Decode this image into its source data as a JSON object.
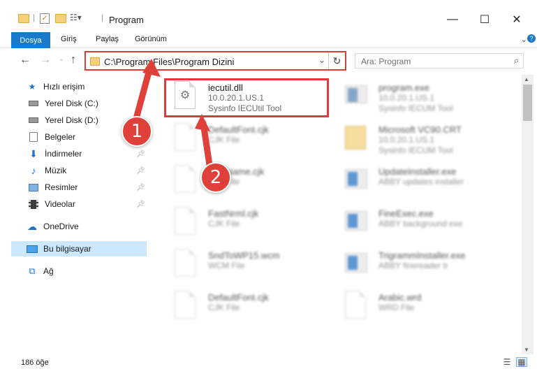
{
  "window": {
    "title": "Program",
    "minimize_glyph": "—",
    "maximize_glyph": "☐",
    "close_glyph": "✕"
  },
  "ribbon": {
    "tabs": [
      {
        "label": "Dosya",
        "active": true
      },
      {
        "label": "Giriş"
      },
      {
        "label": "Paylaş"
      },
      {
        "label": "Görünüm"
      }
    ]
  },
  "address": {
    "path": "C:\\Program Files\\Program Dizini",
    "dropdown_glyph": "⌄",
    "refresh_glyph": "↻"
  },
  "search": {
    "placeholder": "Ara: Program",
    "icon": "search-icon"
  },
  "sidebar": {
    "items": [
      {
        "label": "Hızlı erişim",
        "icon": "star-icon"
      },
      {
        "label": "Yerel Disk (C:)",
        "icon": "drive-icon"
      },
      {
        "label": "Yerel Disk (D:)",
        "icon": "drive-icon"
      },
      {
        "label": "Belgeler",
        "icon": "documents-icon"
      },
      {
        "label": "İndirmeler",
        "icon": "downloads-icon",
        "pinned": true
      },
      {
        "label": "Müzik",
        "icon": "music-icon",
        "pinned": true
      },
      {
        "label": "Resimler",
        "icon": "pictures-icon",
        "pinned": true
      },
      {
        "label": "Videolar",
        "icon": "videos-icon",
        "pinned": true
      },
      {
        "label": "OneDrive",
        "icon": "cloud-icon"
      },
      {
        "label": "Bu bilgisayar",
        "icon": "computer-icon",
        "selected": true
      },
      {
        "label": "Ağ",
        "icon": "network-icon"
      }
    ]
  },
  "files": [
    {
      "name": "iecutil.dll",
      "line2": "10.0.20.1.US.1",
      "line3": "Sysinfo IECUtil Tool",
      "type": "dll",
      "highlighted": true
    },
    {
      "name": "program.exe",
      "line2": "10.0.20.1.US.1",
      "line3": "Sysinfo IECUM Tool",
      "type": "exe",
      "blurred": true
    },
    {
      "name": "DefaultFont.cjk",
      "line2": "CJK File",
      "type": "doc",
      "blurred": true
    },
    {
      "name": "Microsoft VC90.CRT",
      "line2": "10.0.20.1.US.1",
      "line3": "Sysinfo IECUM Tool",
      "type": "folder",
      "blurred": true
    },
    {
      "name": "FontName.cjk",
      "line2": "CJK File",
      "type": "doc",
      "blurred": true
    },
    {
      "name": "UpdateInstaller.exe",
      "line2": "ABBY updates installer",
      "type": "app",
      "blurred": true
    },
    {
      "name": "FastNrml.cjk",
      "line2": "CJK File",
      "type": "doc",
      "blurred": true
    },
    {
      "name": "FineExec.exe",
      "line2": "ABBY background exe",
      "type": "app",
      "blurred": true
    },
    {
      "name": "SndToWP15.wcm",
      "line2": "WCM File",
      "type": "doc",
      "blurred": true
    },
    {
      "name": "TrigrammInstaller.exe",
      "line2": "ABBY finereader tr",
      "type": "app",
      "blurred": true
    },
    {
      "name": "DefaultFont.cjk",
      "line2": "CJK File",
      "type": "doc",
      "blurred": true
    },
    {
      "name": "Arabic.wrd",
      "line2": "WRD File",
      "type": "doc",
      "blurred": true
    }
  ],
  "status": {
    "item_count": "186 öğe"
  },
  "annotations": [
    {
      "number": "1"
    },
    {
      "number": "2"
    }
  ],
  "colors": {
    "accent": "#1979ca",
    "annotation_red": "#e03a3a",
    "selected_bg": "#cce8ff"
  }
}
